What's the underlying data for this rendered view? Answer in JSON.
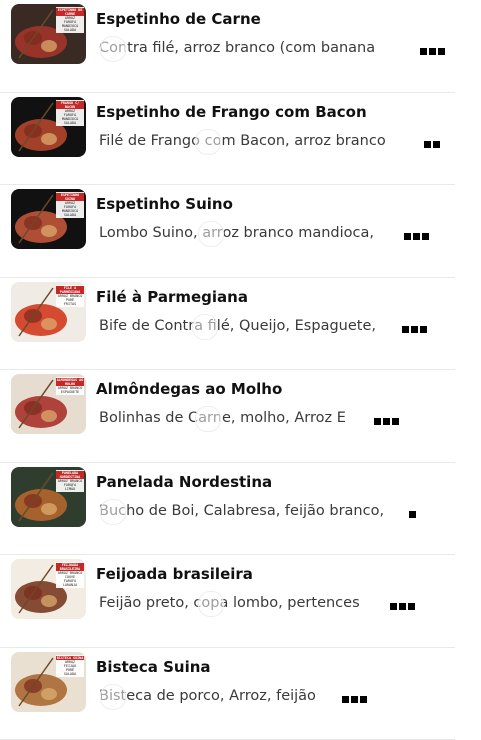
{
  "menu": {
    "items": [
      {
        "title": "Espetinho de Carne",
        "description": "Contra filé, arroz branco (com banana",
        "thumb_tag": [
          "ESPETINHO DE CARNE",
          "ARROZ",
          "FAROFA",
          "MANDIOCA",
          "SALADA"
        ],
        "thumb_bg": "#3a2a24",
        "thumb_accent": "#a3342a"
      },
      {
        "title": "Espetinho de Frango com Bacon",
        "description": "Filé de Frango com Bacon, arroz branco",
        "thumb_tag": [
          "FRANGO C/ BACON",
          "ARROZ",
          "FAROFA",
          "MANDIOCA",
          "SALADA"
        ],
        "thumb_bg": "#111111",
        "thumb_accent": "#b4462e"
      },
      {
        "title": "Espetinho Suino",
        "description": "Lombo Suino, arroz branco  mandioca,",
        "thumb_tag": [
          "ESPETINHO SUINO",
          "ARROZ",
          "FAROFA",
          "MANDIOCA",
          "SALADA"
        ],
        "thumb_bg": "#111111",
        "thumb_accent": "#c0553a"
      },
      {
        "title": "Filé à Parmegiana",
        "description": "Bife de Contra filé, Queijo, Espaguete,",
        "thumb_tag": [
          "FILÉ À PARMEGIANA",
          "ARROZ BRANCO",
          "PURÊ",
          "FRITAS"
        ],
        "thumb_bg": "#f0ebe4",
        "thumb_accent": "#d13a1e"
      },
      {
        "title": "Almôndegas ao Molho",
        "description": "Bolinhas de Carne, molho, Arroz E",
        "thumb_tag": [
          "ALMÔNDEGAS AO MOLHO",
          "ARROZ BRANCO",
          "ESPAGUETE"
        ],
        "thumb_bg": "#e6dccf",
        "thumb_accent": "#a8322a"
      },
      {
        "title": "Panelada Nordestina",
        "description": "Bucho de Boi, Calabresa, feijão branco,",
        "thumb_tag": [
          "PANELADA NORDESTINA",
          "ARROZ BRANCO",
          "FAROFA",
          "LIMÃO"
        ],
        "thumb_bg": "#2f3d2f",
        "thumb_accent": "#b4662e"
      },
      {
        "title": "Feijoada brasileira",
        "description": "Feijão preto, copa lombo, pertences",
        "thumb_tag": [
          "FEIJOADA BRASILEIRA",
          "ARROZ BRANCO",
          "COUVE",
          "FAROFA",
          "LARANJA"
        ],
        "thumb_bg": "#f2ece2",
        "thumb_accent": "#7a3a22"
      },
      {
        "title": "Bisteca Suina",
        "description": "Bisteca de porco, Arroz, feijão",
        "thumb_tag": [
          "BISTECA SUINA",
          "ARROZ",
          "FEIJÃO",
          "PURÊ",
          "SALADA"
        ],
        "thumb_bg": "#e9e0d2",
        "thumb_accent": "#a86a34"
      }
    ]
  }
}
